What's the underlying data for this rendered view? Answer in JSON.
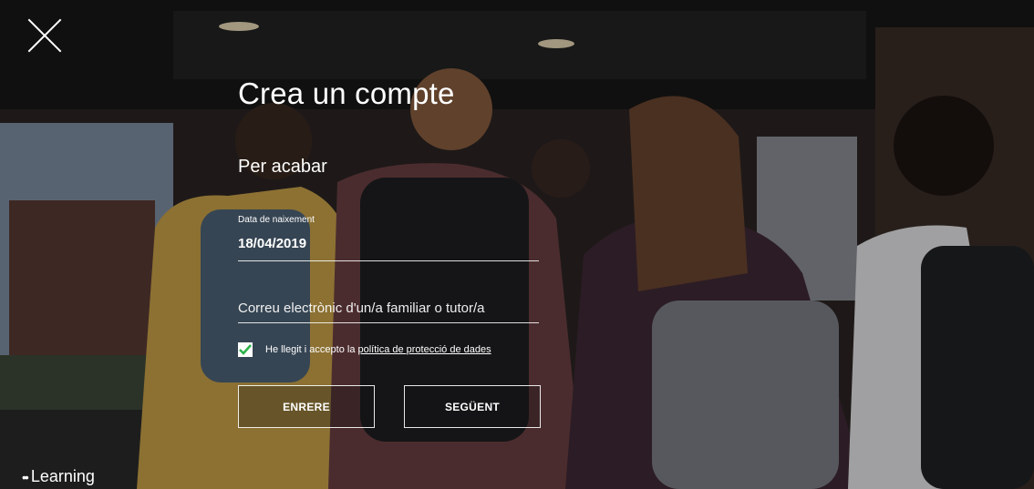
{
  "dialog": {
    "title": "Crea un compte",
    "subtitle": "Per acabar"
  },
  "form": {
    "dob_label": "Data de naixement",
    "dob_value": "18/04/2019",
    "email_placeholder": "Correu electrònic d'un/a familiar o tutor/a",
    "consent_text": "He llegit i accepto la",
    "consent_link": "política de protecció de dades",
    "consent_checked": true
  },
  "buttons": {
    "back": "ENRERE",
    "next": "SEGÜENT"
  },
  "brand": {
    "name": "Learning",
    "dots": "••"
  },
  "colors": {
    "checkbox_check": "#2db34a",
    "text": "#ffffff"
  }
}
